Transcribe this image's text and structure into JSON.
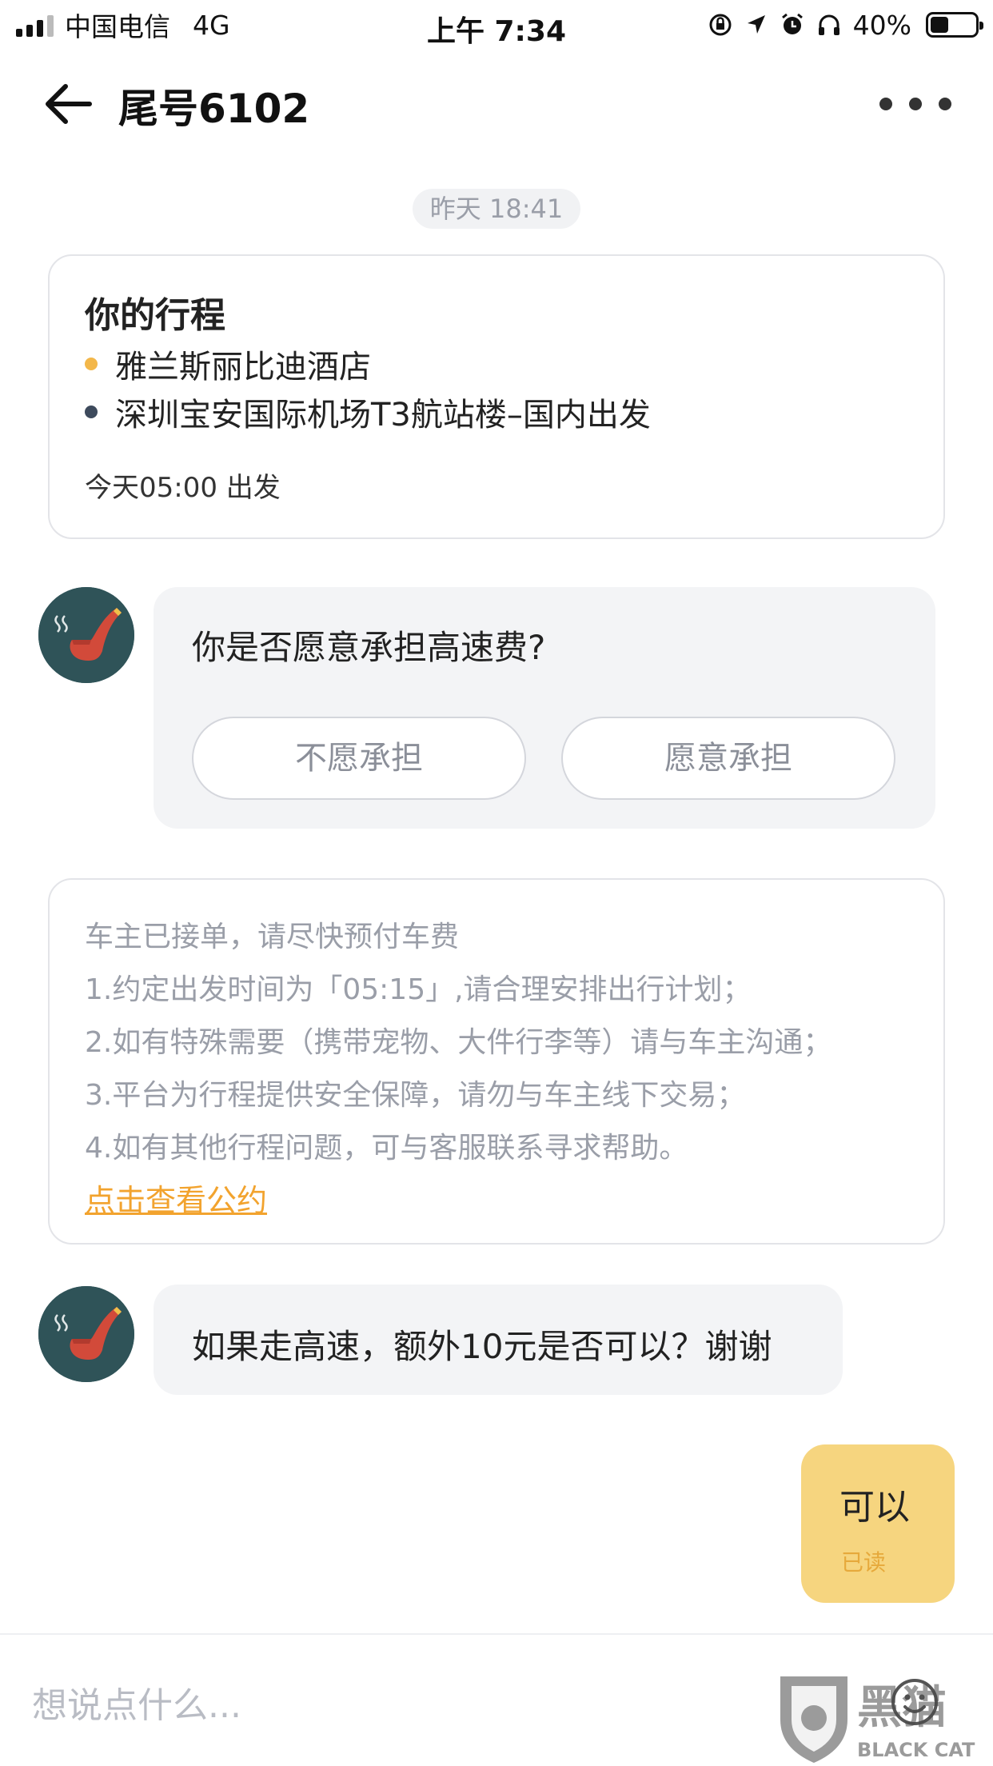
{
  "status_bar": {
    "carrier": "中国电信",
    "network": "4G",
    "time": "上午 7:34",
    "battery": "40%",
    "battery_level": 0.4
  },
  "nav": {
    "title": "尾号6102",
    "back_icon": "arrow-left-icon",
    "more_icon": "more-horizontal-icon"
  },
  "timestamp": "昨天 18:41",
  "trip": {
    "title": "你的行程",
    "origin": "雅兰斯丽比迪酒店",
    "destination": "深圳宝安国际机场T3航站楼–国内出发",
    "departure": "今天05:00 出发",
    "origin_dot_color": "#f3b74a",
    "destination_dot_color": "#3d4a5c"
  },
  "question": {
    "text": "你是否愿意承担高速费?",
    "option_decline": "不愿承担",
    "option_accept": "愿意承担"
  },
  "notice": {
    "lines": [
      "车主已接单，请尽快预付车费",
      "1.约定出发时间为「05:15」,请合理安排出行计划；",
      "2.如有特殊需要（携带宠物、大件行李等）请与车主沟通；",
      "3.平台为行程提供安全保障，请勿与车主线下交易；",
      "4.如有其他行程问题，可与客服联系寻求帮助。"
    ],
    "link": "点击查看公约",
    "link_color": "#f2a32e"
  },
  "message": {
    "text": "如果走高速，额外10元是否可以？谢谢"
  },
  "reply": {
    "text": "可以",
    "status": "已读",
    "bubble_color": "#f6d57f"
  },
  "input": {
    "placeholder": "想说点什么..."
  },
  "watermark": {
    "text_cn": "黑猫",
    "text_en": "BLACK CAT"
  }
}
